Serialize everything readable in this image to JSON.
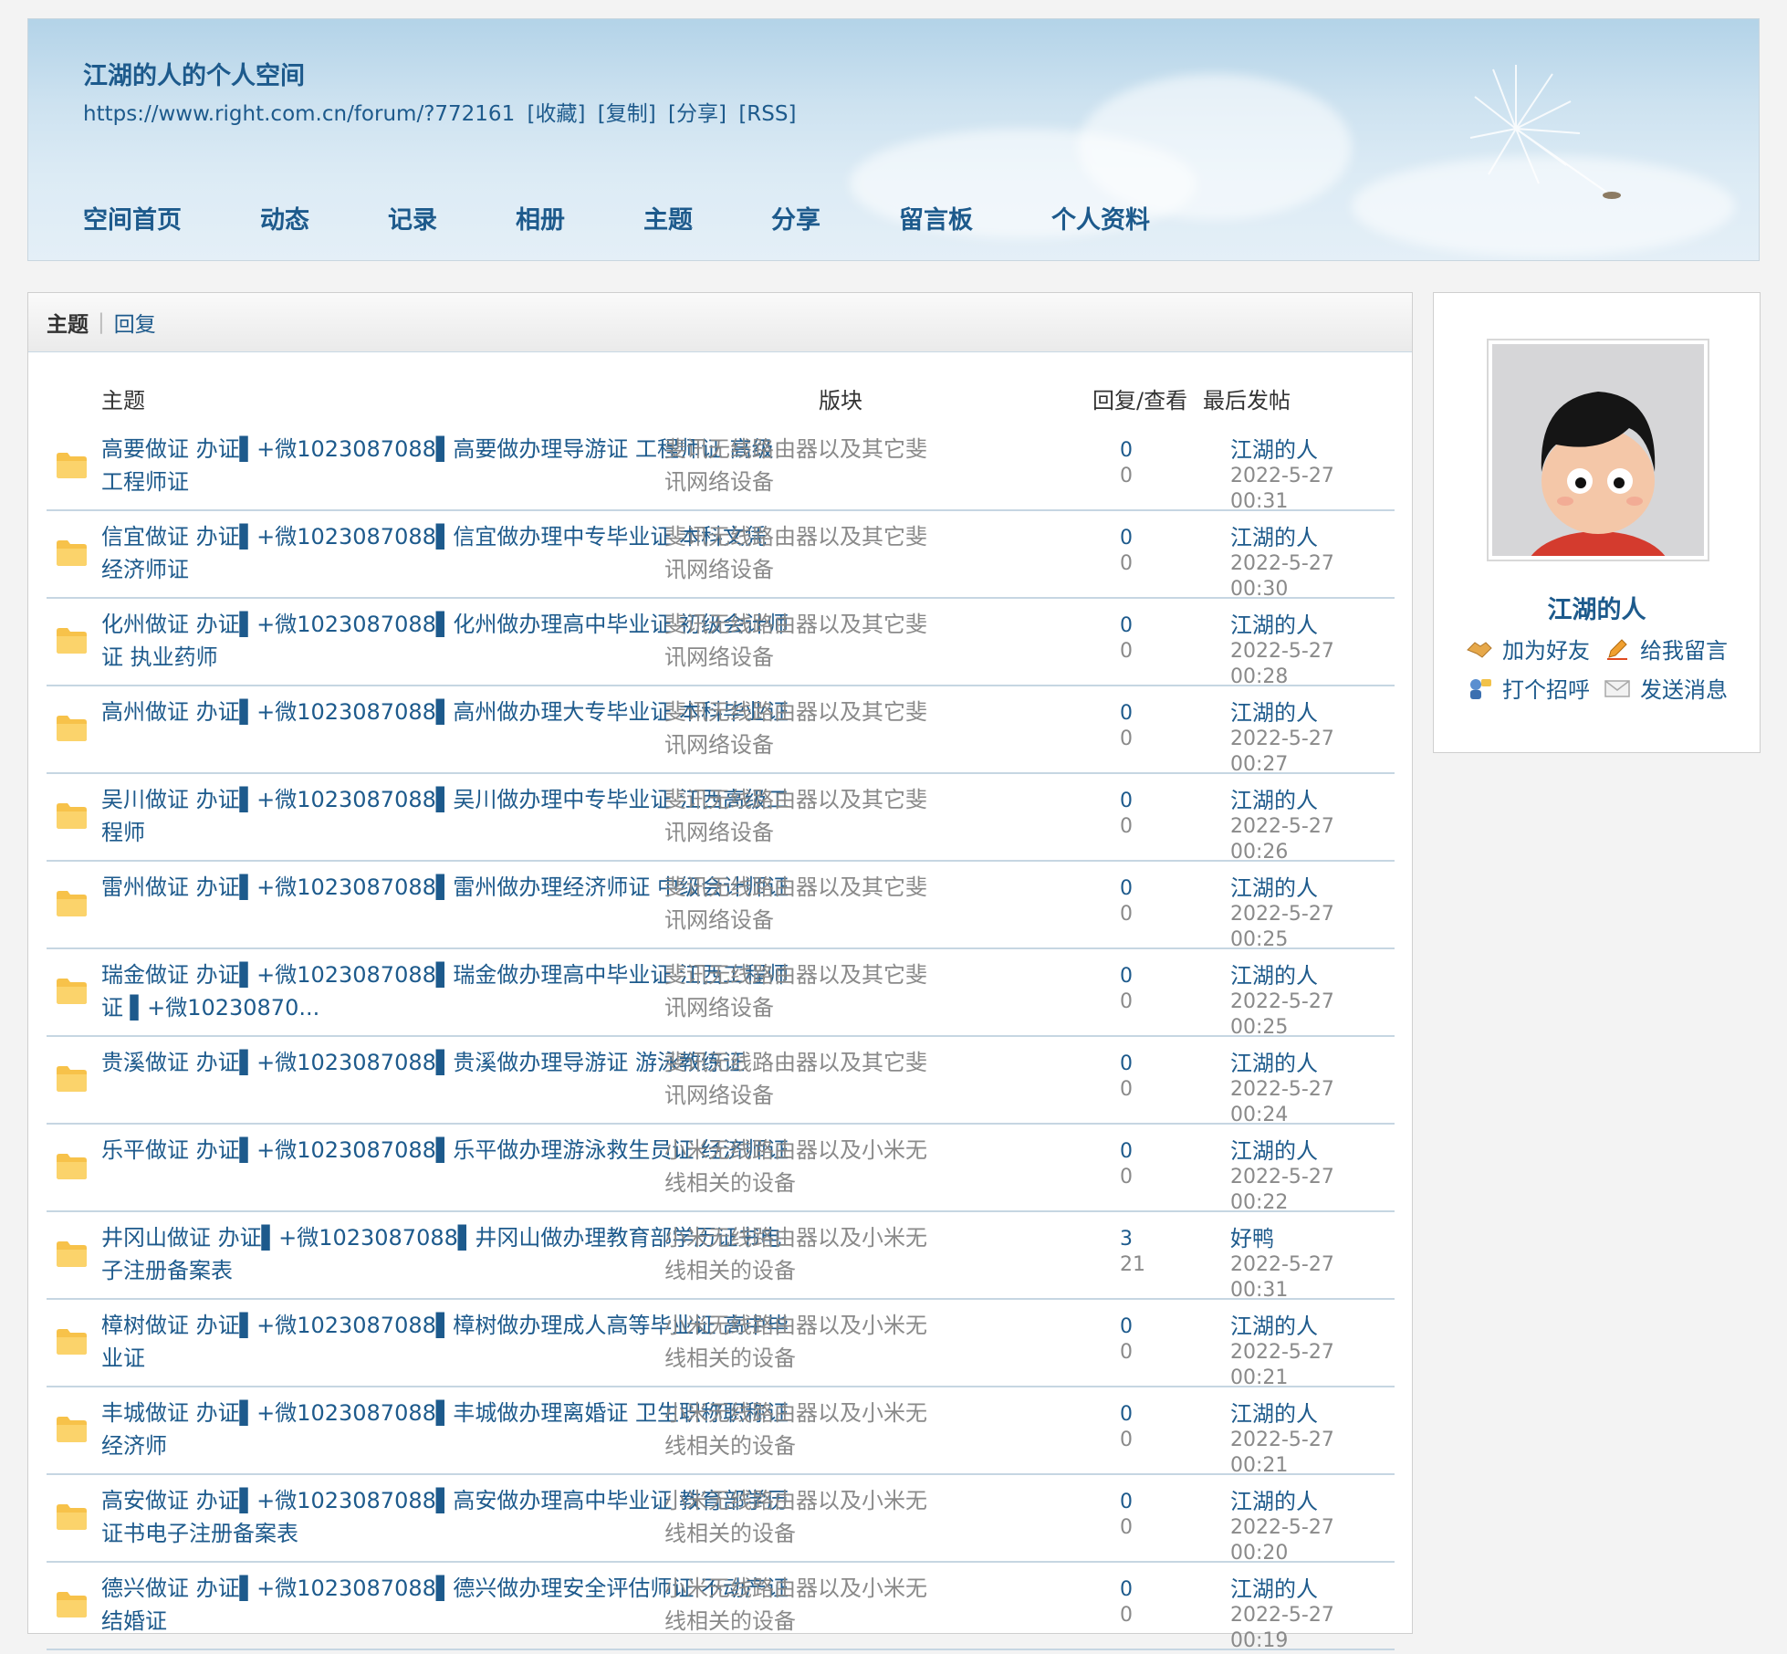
{
  "header": {
    "title": "江湖的人的个人空间",
    "url": "https://www.right.com.cn/forum/?772161",
    "links": [
      "[收藏]",
      "[复制]",
      "[分享]",
      "[RSS]"
    ],
    "nav": [
      "空间首页",
      "动态",
      "记录",
      "相册",
      "主题",
      "分享",
      "留言板",
      "个人资料"
    ]
  },
  "tabs": {
    "active": "主题",
    "other": "回复"
  },
  "columns": {
    "topic": "主题",
    "forum": "版块",
    "stats": "回复/查看",
    "last": "最后发帖"
  },
  "threads": [
    {
      "title": "高要做证 办证▌+微1023087088▌高要做办理导游证 工程师证 高级工程师证",
      "forum": "斐讯无线路由器以及其它斐讯网络设备",
      "replies": "0",
      "views": "0",
      "last_user": "江湖的人",
      "last_time": "2022-5-27 00:31"
    },
    {
      "title": "信宜做证 办证▌+微1023087088▌信宜做办理中专毕业证 本科文凭 经济师证",
      "forum": "斐讯无线路由器以及其它斐讯网络设备",
      "replies": "0",
      "views": "0",
      "last_user": "江湖的人",
      "last_time": "2022-5-27 00:30"
    },
    {
      "title": "化州做证 办证▌+微1023087088▌化州做办理高中毕业证 初级会计师证 执业药师",
      "forum": "斐讯无线路由器以及其它斐讯网络设备",
      "replies": "0",
      "views": "0",
      "last_user": "江湖的人",
      "last_time": "2022-5-27 00:28"
    },
    {
      "title": "高州做证 办证▌+微1023087088▌高州做办理大专毕业证 本科毕业证",
      "forum": "斐讯无线路由器以及其它斐讯网络设备",
      "replies": "0",
      "views": "0",
      "last_user": "江湖的人",
      "last_time": "2022-5-27 00:27"
    },
    {
      "title": "吴川做证 办证▌+微1023087088▌吴川做办理中专毕业证 江西高级工程师",
      "forum": "斐讯无线路由器以及其它斐讯网络设备",
      "replies": "0",
      "views": "0",
      "last_user": "江湖的人",
      "last_time": "2022-5-27 00:26"
    },
    {
      "title": "雷州做证 办证▌+微1023087088▌雷州做办理经济师证 中级会计师证",
      "forum": "斐讯无线路由器以及其它斐讯网络设备",
      "replies": "0",
      "views": "0",
      "last_user": "江湖的人",
      "last_time": "2022-5-27 00:25"
    },
    {
      "title": "瑞金做证 办证▌+微1023087088▌瑞金做办理高中毕业证 江西工程师证 ▌+微10230870...",
      "forum": "斐讯无线路由器以及其它斐讯网络设备",
      "replies": "0",
      "views": "0",
      "last_user": "江湖的人",
      "last_time": "2022-5-27 00:25"
    },
    {
      "title": "贵溪做证 办证▌+微1023087088▌贵溪做办理导游证 游泳教练证",
      "forum": "斐讯无线路由器以及其它斐讯网络设备",
      "replies": "0",
      "views": "0",
      "last_user": "江湖的人",
      "last_time": "2022-5-27 00:24"
    },
    {
      "title": "乐平做证 办证▌+微1023087088▌乐平做办理游泳救生员证 经济师证",
      "forum": "小米无线路由器以及小米无线相关的设备",
      "replies": "0",
      "views": "0",
      "last_user": "江湖的人",
      "last_time": "2022-5-27 00:22"
    },
    {
      "title": "井冈山做证 办证▌+微1023087088▌井冈山做办理教育部学历证书电子注册备案表",
      "forum": "小米无线路由器以及小米无线相关的设备",
      "replies": "3",
      "views": "21",
      "last_user": "好鸭",
      "last_time": "2022-5-27 00:31"
    },
    {
      "title": "樟树做证 办证▌+微1023087088▌樟树做办理成人高等毕业证 高中毕业证",
      "forum": "小米无线路由器以及小米无线相关的设备",
      "replies": "0",
      "views": "0",
      "last_user": "江湖的人",
      "last_time": "2022-5-27 00:21"
    },
    {
      "title": "丰城做证 办证▌+微1023087088▌丰城做办理离婚证 卫生职称职称证 经济师",
      "forum": "小米无线路由器以及小米无线相关的设备",
      "replies": "0",
      "views": "0",
      "last_user": "江湖的人",
      "last_time": "2022-5-27 00:21"
    },
    {
      "title": "高安做证 办证▌+微1023087088▌高安做办理高中毕业证 教育部学历证书电子注册备案表",
      "forum": "小米无线路由器以及小米无线相关的设备",
      "replies": "0",
      "views": "0",
      "last_user": "江湖的人",
      "last_time": "2022-5-27 00:20"
    },
    {
      "title": "德兴做证 办证▌+微1023087088▌德兴做办理安全评估师证 不动产证 结婚证",
      "forum": "小米无线路由器以及小米无线相关的设备",
      "replies": "0",
      "views": "0",
      "last_user": "江湖的人",
      "last_time": "2022-5-27 00:19"
    }
  ],
  "sidebar": {
    "username": "江湖的人",
    "actions": [
      {
        "label": "加为好友",
        "icon": "handshake-icon"
      },
      {
        "label": "给我留言",
        "icon": "pencil-icon"
      },
      {
        "label": "打个招呼",
        "icon": "greet-icon"
      },
      {
        "label": "发送消息",
        "icon": "envelope-icon"
      }
    ]
  },
  "colors": {
    "link": "#1d5a8c",
    "muted": "#8a8a8a",
    "folder": "#f7c24a"
  }
}
